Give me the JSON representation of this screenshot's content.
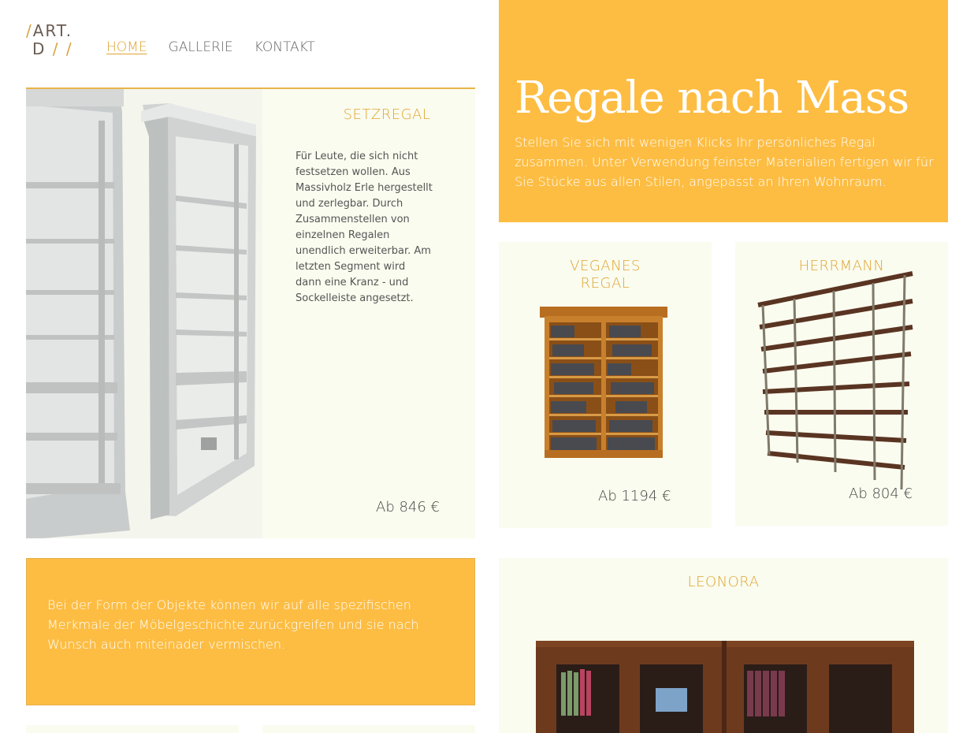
{
  "logo": {
    "line1": "ART.",
    "line2": "D",
    "slash": "/",
    "slashes": "/ /"
  },
  "nav": [
    {
      "label": "HOME",
      "active": true
    },
    {
      "label": "GALLERIE",
      "active": false
    },
    {
      "label": "KONTAKT",
      "active": false
    }
  ],
  "hero": {
    "title": "Regale nach Mass",
    "text": "Stellen Sie sich mit wenigen Klicks Ihr persönliches Regal zusammen. Unter Verwendung feinster Materialien fertigen wir für Sie Stücke aus allen Stilen, angepasst an Ihren Wohnraum."
  },
  "products": {
    "setzregal": {
      "title": "SETZREGAL",
      "description": "Für Leute, die sich nicht festsetzen wollen. Aus Massivholz Erle hergestellt und zerlegbar. Durch Zusammenstellen von einzelnen Regalen unendlich erweiterbar. Am letzten Segment wird dann eine Kranz - und Sockelleiste angesetzt.",
      "price": "Ab 846 €"
    },
    "veganes": {
      "title": "VEGANES REGAL",
      "price": "Ab 1194 €"
    },
    "herrmann": {
      "title": "HERRMANN",
      "price": "Ab 804 €"
    },
    "leonora": {
      "title": "LEONORA"
    }
  },
  "info": {
    "text": "Bei der Form der Objekte können wir auf alle spezifischen Merkmale der Möbelgeschichte zurückgreifen und sie nach Wunsch auch miteinader vermischen."
  },
  "colors": {
    "accent": "#fdbd43",
    "title": "#e0a330",
    "card": "#fafcef"
  }
}
